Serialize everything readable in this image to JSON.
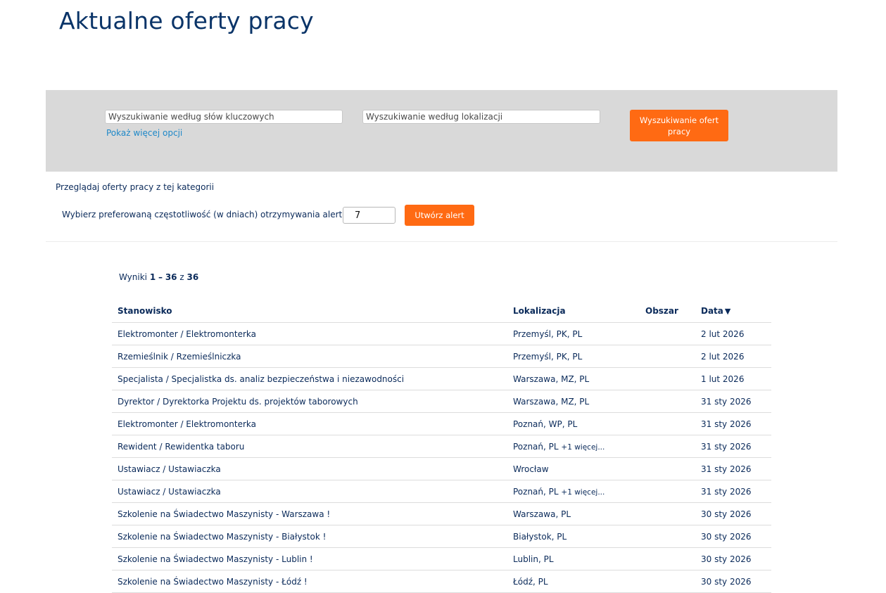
{
  "page": {
    "title": "Aktualne oferty pracy"
  },
  "search": {
    "keyword_placeholder": "Wyszukiwanie według słów kluczowych",
    "keyword_value": "",
    "location_placeholder": "Wyszukiwanie według lokalizacji",
    "location_value": "",
    "more_options_label": "Pokaż więcej opcji",
    "submit_label": "Wyszukiwanie ofert pracy"
  },
  "browse": {
    "text": "Przeglądaj oferty pracy z tej kategorii"
  },
  "alert": {
    "label": "Wybierz preferowaną częstotliwość (w dniach) otrzymywania alertów:",
    "frequency_value": "7",
    "button_label": "Utwórz alert"
  },
  "results": {
    "prefix": "Wyniki",
    "from": "1",
    "dash": "–",
    "to": "36",
    "of_word": "z",
    "total": "36"
  },
  "table": {
    "headers": {
      "title": "Stanowisko",
      "location": "Lokalizacja",
      "area": "Obszar",
      "date": "Data",
      "sort_icon": "sort-desc-icon"
    },
    "rows": [
      {
        "title": "Elektromonter / Elektromonterka",
        "location": "Przemyśl, PK, PL",
        "more": "",
        "area": "",
        "date": "2 lut 2026"
      },
      {
        "title": "Rzemieślnik / Rzemieślniczka",
        "location": "Przemyśl, PK, PL",
        "more": "",
        "area": "",
        "date": "2 lut 2026"
      },
      {
        "title": "Specjalista / Specjalistka ds. analiz bezpieczeństwa i niezawodności",
        "location": "Warszawa, MZ, PL",
        "more": "",
        "area": "",
        "date": "1 lut 2026"
      },
      {
        "title": "Dyrektor / Dyrektorka Projektu ds. projektów taborowych",
        "location": "Warszawa, MZ, PL",
        "more": "",
        "area": "",
        "date": "31 sty 2026"
      },
      {
        "title": "Elektromonter / Elektromonterka",
        "location": "Poznań, WP, PL",
        "more": "",
        "area": "",
        "date": "31 sty 2026"
      },
      {
        "title": "Rewident / Rewidentka taboru",
        "location": "Poznań, PL",
        "more": "+1 więcej...",
        "area": "",
        "date": "31 sty 2026"
      },
      {
        "title": "Ustawiacz / Ustawiaczka",
        "location": "Wrocław",
        "more": "",
        "area": "",
        "date": "31 sty 2026"
      },
      {
        "title": "Ustawiacz / Ustawiaczka",
        "location": "Poznań, PL",
        "more": "+1 więcej...",
        "area": "",
        "date": "31 sty 2026"
      },
      {
        "title": "Szkolenie na Świadectwo Maszynisty - Warszawa !",
        "location": "Warszawa, PL",
        "more": "",
        "area": "",
        "date": "30 sty 2026"
      },
      {
        "title": "Szkolenie na Świadectwo Maszynisty - Białystok !",
        "location": "Białystok, PL",
        "more": "",
        "area": "",
        "date": "30 sty 2026"
      },
      {
        "title": "Szkolenie na Świadectwo Maszynisty - Lublin !",
        "location": "Lublin, PL",
        "more": "",
        "area": "",
        "date": "30 sty 2026"
      },
      {
        "title": "Szkolenie na Świadectwo Maszynisty - Łódź !",
        "location": "Łódź, PL",
        "more": "",
        "area": "",
        "date": "30 sty 2026"
      }
    ]
  },
  "colors": {
    "accent": "#ff6a13",
    "title": "#0a3468",
    "text": "#0a2a5a",
    "link": "#1e88c8",
    "panel": "#d9d9d9"
  }
}
